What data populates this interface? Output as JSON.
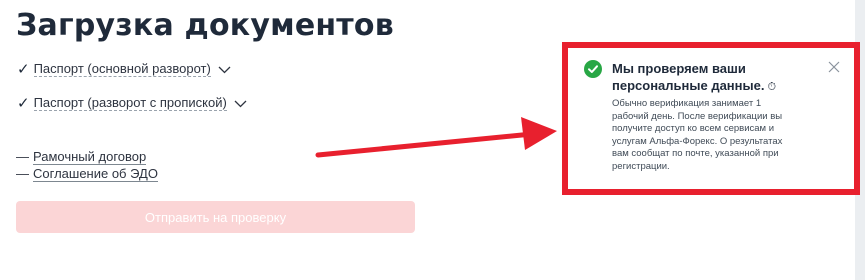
{
  "page": {
    "title": "Загрузка документов"
  },
  "documents": [
    {
      "label": "Паспорт (основной разворот)",
      "status": "uploaded"
    },
    {
      "label": "Паспорт (разворот с пропиской)",
      "status": "uploaded"
    }
  ],
  "links": [
    {
      "prefix": "—",
      "label": "Рамочный договор"
    },
    {
      "prefix": "—",
      "label": "Соглашение об ЭДО"
    }
  ],
  "submit_button": {
    "label": "Отправить на проверку",
    "state": "disabled"
  },
  "notification": {
    "title": "Мы проверяем ваши персональные данные.",
    "emoji": "⏱",
    "body": "Обычно верификация занимает 1 рабочий день. После верификации вы получите доступ ко всем сервисам и услугам Альфа-Форекс. О результатах вам сообщат по почте, указанной при регистрации.",
    "icon": "check-circle-icon",
    "close_icon": "close-icon"
  },
  "annotation": {
    "arrow_color": "#e8202e",
    "highlight_color": "#e8202e"
  },
  "colors": {
    "title": "#1f2a3a",
    "button_disabled_bg": "#fbd5d6",
    "success": "#28a745"
  }
}
